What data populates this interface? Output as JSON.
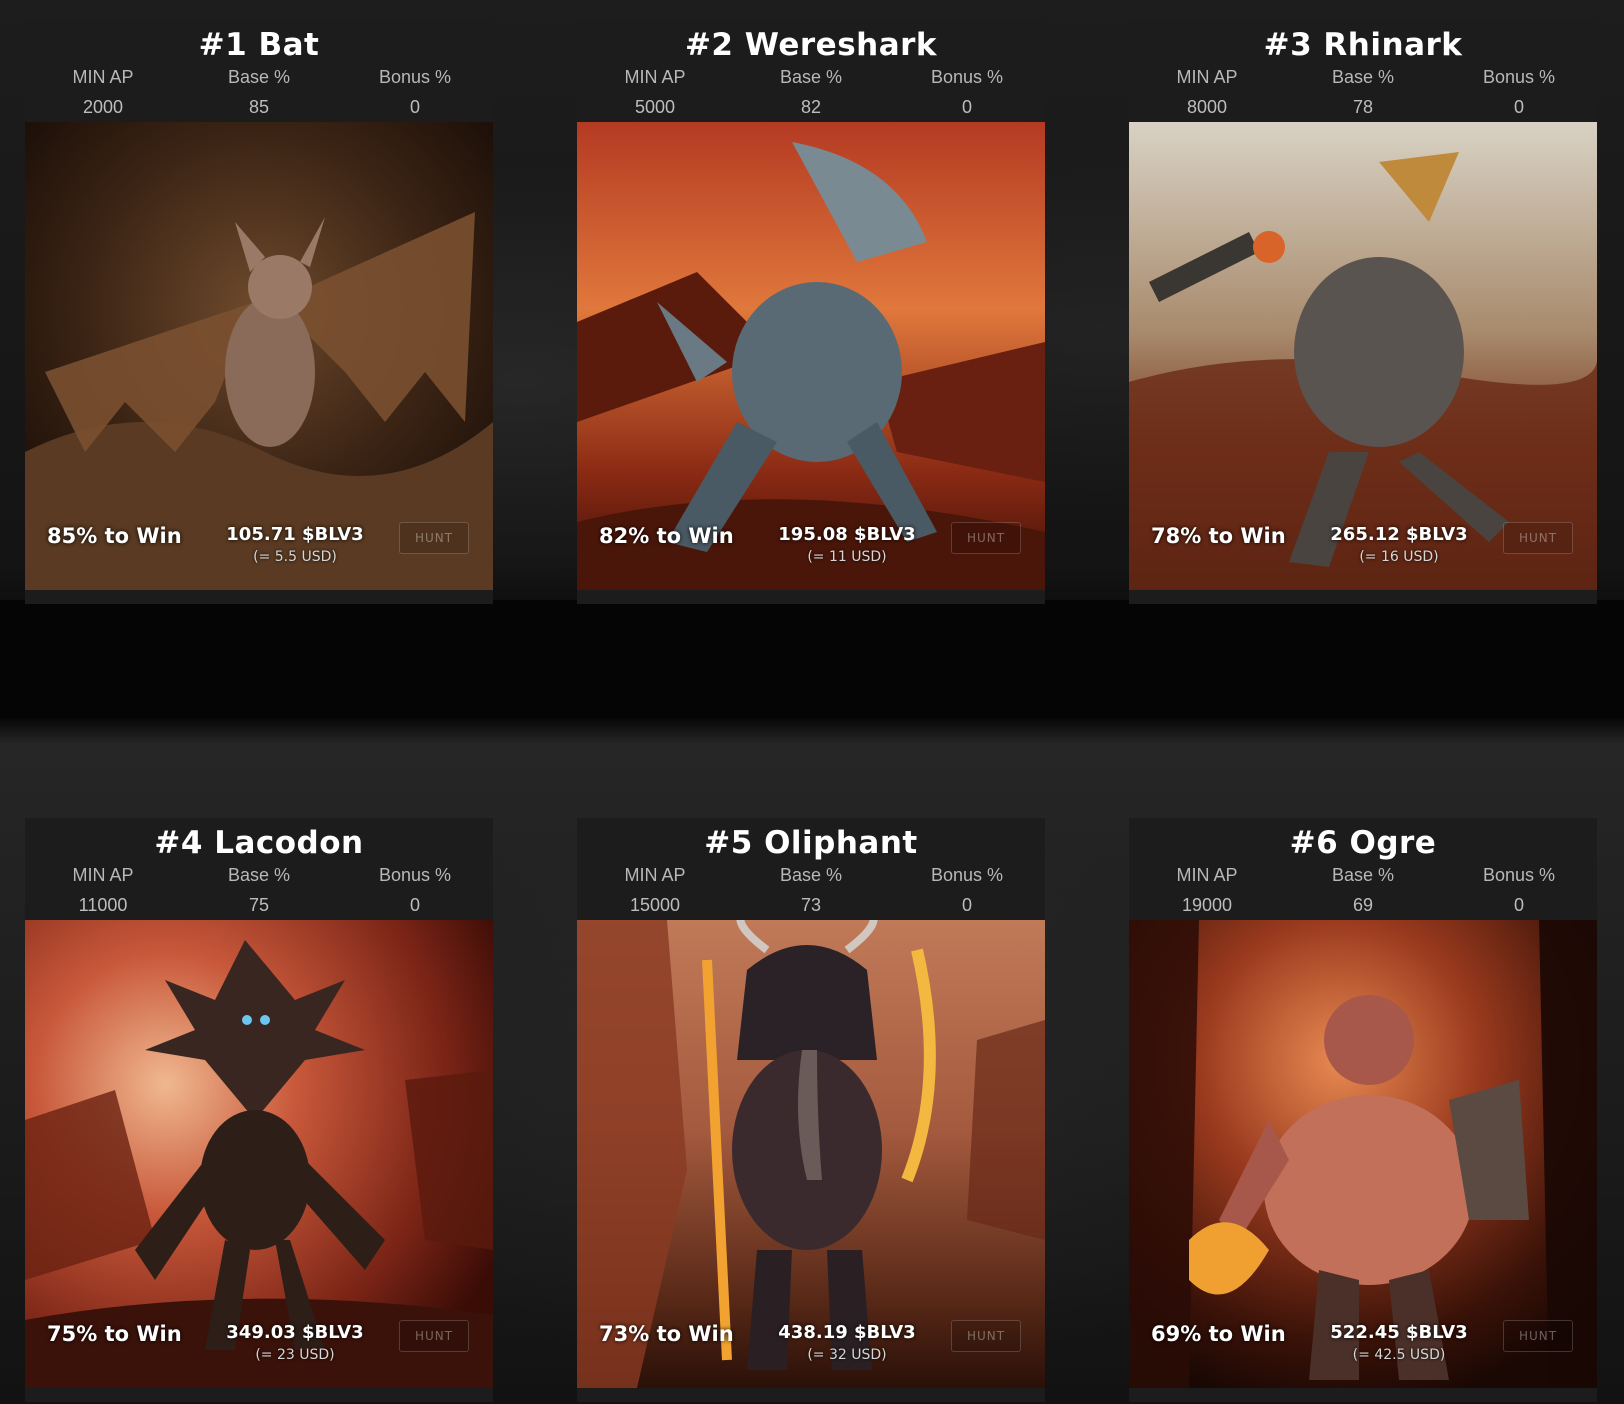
{
  "labels": {
    "min_ap": "MIN AP",
    "base": "Base %",
    "bonus": "Bonus %",
    "hunt": "HUNT"
  },
  "monsters": [
    {
      "title": "#1 Bat",
      "min_ap": "2000",
      "base": "85",
      "bonus": "0",
      "win": "85% to Win",
      "reward": "105.71 $BLV3",
      "usd": "(= 5.5 USD)"
    },
    {
      "title": "#2 Wereshark",
      "min_ap": "5000",
      "base": "82",
      "bonus": "0",
      "win": "82% to Win",
      "reward": "195.08 $BLV3",
      "usd": "(= 11 USD)"
    },
    {
      "title": "#3 Rhinark",
      "min_ap": "8000",
      "base": "78",
      "bonus": "0",
      "win": "78% to Win",
      "reward": "265.12 $BLV3",
      "usd": "(= 16 USD)"
    },
    {
      "title": "#4 Lacodon",
      "min_ap": "11000",
      "base": "75",
      "bonus": "0",
      "win": "75% to Win",
      "reward": "349.03 $BLV3",
      "usd": "(= 23 USD)"
    },
    {
      "title": "#5 Oliphant",
      "min_ap": "15000",
      "base": "73",
      "bonus": "0",
      "win": "73% to Win",
      "reward": "438.19 $BLV3",
      "usd": "(= 32 USD)"
    },
    {
      "title": "#6 Ogre",
      "min_ap": "19000",
      "base": "69",
      "bonus": "0",
      "win": "69% to Win",
      "reward": "522.45 $BLV3",
      "usd": "(= 42.5 USD)"
    }
  ]
}
